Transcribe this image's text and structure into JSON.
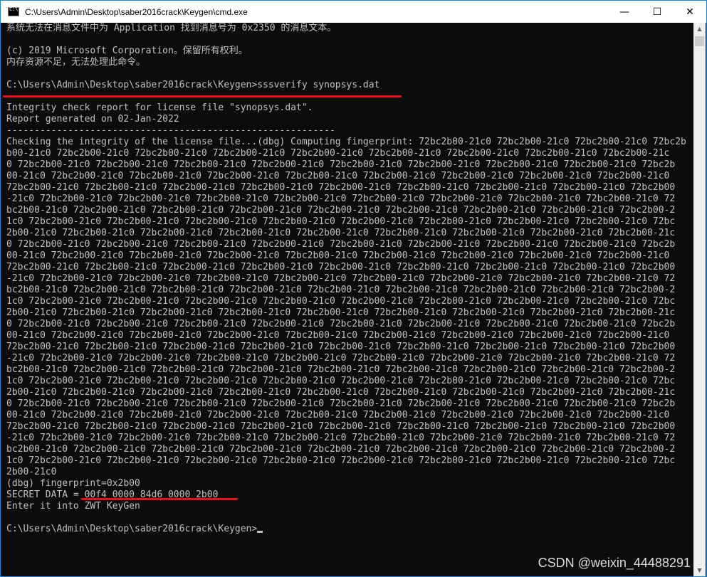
{
  "window": {
    "title": "C:\\Users\\Admin\\Desktop\\saber2016crack\\Keygen\\cmd.exe",
    "minimize_glyph": "—",
    "maximize_glyph": "☐",
    "close_glyph": "✕"
  },
  "console": {
    "lines": [
      "系统无法在消息文件中为 Application 找到消息号为 0x2350 的消息文本。",
      "",
      "(c) 2019 Microsoft Corporation。保留所有权利。",
      "内存资源不足，无法处理此命令。",
      "",
      "C:\\Users\\Admin\\Desktop\\saber2016crack\\Keygen>sssverify synopsys.dat",
      "",
      "Integrity check report for license file \"synopsys.dat\".",
      "Report generated on 02-Jan-2022",
      "-----------------------------------------------------------",
      "Checking the integrity of the license file...(dbg) Computing fingerprint: 72bc2b00-21c0 72bc2b00-21c0 72bc2b00-21c0 72bc2b",
      "b00-21c0 72bc2b00-21c0 72bc2b00-21c0 72bc2b00-21c0 72bc2b00-21c0 72bc2b00-21c0 72bc2b00-21c0 72bc2b00-21c0 72bc2b00-21c",
      "0 72bc2b00-21c0 72bc2b00-21c0 72bc2b00-21c0 72bc2b00-21c0 72bc2b00-21c0 72bc2b00-21c0 72bc2b00-21c0 72bc2b00-21c0 72bc2b",
      "00-21c0 72bc2b00-21c0 72bc2b00-21c0 72bc2b00-21c0 72bc2b00-21c0 72bc2b00-21c0 72bc2b00-21c0 72bc2b00-21c0 72bc2b00-21c0",
      "72bc2b00-21c0 72bc2b00-21c0 72bc2b00-21c0 72bc2b00-21c0 72bc2b00-21c0 72bc2b00-21c0 72bc2b00-21c0 72bc2b00-21c0 72bc2b00",
      "-21c0 72bc2b00-21c0 72bc2b00-21c0 72bc2b00-21c0 72bc2b00-21c0 72bc2b00-21c0 72bc2b00-21c0 72bc2b00-21c0 72bc2b00-21c0 72",
      "bc2b00-21c0 72bc2b00-21c0 72bc2b00-21c0 72bc2b00-21c0 72bc2b00-21c0 72bc2b00-21c0 72bc2b00-21c0 72bc2b00-21c0 72bc2b00-2",
      "1c0 72bc2b00-21c0 72bc2b00-21c0 72bc2b00-21c0 72bc2b00-21c0 72bc2b00-21c0 72bc2b00-21c0 72bc2b00-21c0 72bc2b00-21c0 72bc",
      "2b00-21c0 72bc2b00-21c0 72bc2b00-21c0 72bc2b00-21c0 72bc2b00-21c0 72bc2b00-21c0 72bc2b00-21c0 72bc2b00-21c0 72bc2b00-21c",
      "0 72bc2b00-21c0 72bc2b00-21c0 72bc2b00-21c0 72bc2b00-21c0 72bc2b00-21c0 72bc2b00-21c0 72bc2b00-21c0 72bc2b00-21c0 72bc2b",
      "00-21c0 72bc2b00-21c0 72bc2b00-21c0 72bc2b00-21c0 72bc2b00-21c0 72bc2b00-21c0 72bc2b00-21c0 72bc2b00-21c0 72bc2b00-21c0",
      "72bc2b00-21c0 72bc2b00-21c0 72bc2b00-21c0 72bc2b00-21c0 72bc2b00-21c0 72bc2b00-21c0 72bc2b00-21c0 72bc2b00-21c0 72bc2b00",
      "-21c0 72bc2b00-21c0 72bc2b00-21c0 72bc2b00-21c0 72bc2b00-21c0 72bc2b00-21c0 72bc2b00-21c0 72bc2b00-21c0 72bc2b00-21c0 72",
      "bc2b00-21c0 72bc2b00-21c0 72bc2b00-21c0 72bc2b00-21c0 72bc2b00-21c0 72bc2b00-21c0 72bc2b00-21c0 72bc2b00-21c0 72bc2b00-2",
      "1c0 72bc2b00-21c0 72bc2b00-21c0 72bc2b00-21c0 72bc2b00-21c0 72bc2b00-21c0 72bc2b00-21c0 72bc2b00-21c0 72bc2b00-21c0 72bc",
      "2b00-21c0 72bc2b00-21c0 72bc2b00-21c0 72bc2b00-21c0 72bc2b00-21c0 72bc2b00-21c0 72bc2b00-21c0 72bc2b00-21c0 72bc2b00-21c",
      "0 72bc2b00-21c0 72bc2b00-21c0 72bc2b00-21c0 72bc2b00-21c0 72bc2b00-21c0 72bc2b00-21c0 72bc2b00-21c0 72bc2b00-21c0 72bc2b",
      "00-21c0 72bc2b00-21c0 72bc2b00-21c0 72bc2b00-21c0 72bc2b00-21c0 72bc2b00-21c0 72bc2b00-21c0 72bc2b00-21c0 72bc2b00-21c0",
      "72bc2b00-21c0 72bc2b00-21c0 72bc2b00-21c0 72bc2b00-21c0 72bc2b00-21c0 72bc2b00-21c0 72bc2b00-21c0 72bc2b00-21c0 72bc2b00",
      "-21c0 72bc2b00-21c0 72bc2b00-21c0 72bc2b00-21c0 72bc2b00-21c0 72bc2b00-21c0 72bc2b00-21c0 72bc2b00-21c0 72bc2b00-21c0 72",
      "bc2b00-21c0 72bc2b00-21c0 72bc2b00-21c0 72bc2b00-21c0 72bc2b00-21c0 72bc2b00-21c0 72bc2b00-21c0 72bc2b00-21c0 72bc2b00-2",
      "1c0 72bc2b00-21c0 72bc2b00-21c0 72bc2b00-21c0 72bc2b00-21c0 72bc2b00-21c0 72bc2b00-21c0 72bc2b00-21c0 72bc2b00-21c0 72bc",
      "2b00-21c0 72bc2b00-21c0 72bc2b00-21c0 72bc2b00-21c0 72bc2b00-21c0 72bc2b00-21c0 72bc2b00-21c0 72bc2b00-21c0 72bc2b00-21c",
      "0 72bc2b00-21c0 72bc2b00-21c0 72bc2b00-21c0 72bc2b00-21c0 72bc2b00-21c0 72bc2b00-21c0 72bc2b00-21c0 72bc2b00-21c0 72bc2b",
      "00-21c0 72bc2b00-21c0 72bc2b00-21c0 72bc2b00-21c0 72bc2b00-21c0 72bc2b00-21c0 72bc2b00-21c0 72bc2b00-21c0 72bc2b00-21c0",
      "72bc2b00-21c0 72bc2b00-21c0 72bc2b00-21c0 72bc2b00-21c0 72bc2b00-21c0 72bc2b00-21c0 72bc2b00-21c0 72bc2b00-21c0 72bc2b00",
      "-21c0 72bc2b00-21c0 72bc2b00-21c0 72bc2b00-21c0 72bc2b00-21c0 72bc2b00-21c0 72bc2b00-21c0 72bc2b00-21c0 72bc2b00-21c0 72",
      "bc2b00-21c0 72bc2b00-21c0 72bc2b00-21c0 72bc2b00-21c0 72bc2b00-21c0 72bc2b00-21c0 72bc2b00-21c0 72bc2b00-21c0 72bc2b00-2",
      "1c0 72bc2b00-21c0 72bc2b00-21c0 72bc2b00-21c0 72bc2b00-21c0 72bc2b00-21c0 72bc2b00-21c0 72bc2b00-21c0 72bc2b00-21c0 72bc",
      "2b00-21c0",
      "(dbg) fingerprint=0x2b00",
      "SECRET DATA = 00f4 0000 84d6 0000 2b00",
      "Enter it into ZWT KeyGen",
      "",
      "C:\\Users\\Admin\\Desktop\\saber2016crack\\Keygen>"
    ]
  },
  "watermark": "CSDN @weixin_44488291",
  "colors": {
    "console_bg": "#0c0c0c",
    "console_text": "#c0c0c0",
    "annotation": "#e8101a"
  }
}
